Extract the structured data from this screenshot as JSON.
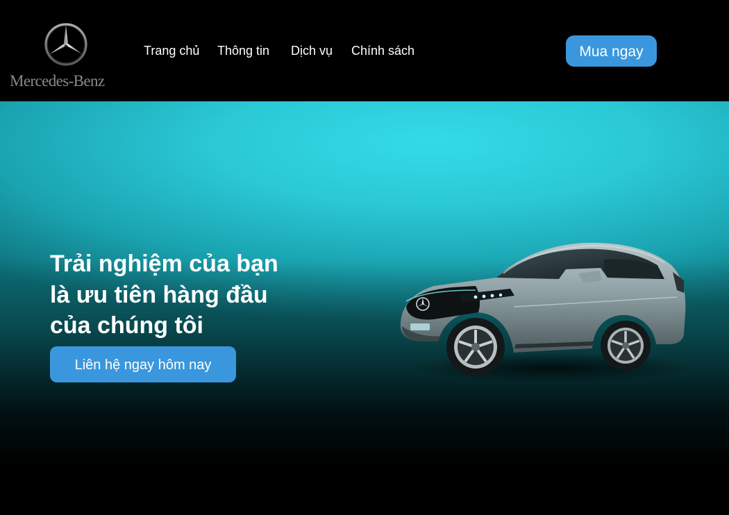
{
  "brand": {
    "name": "Mercedes-Benz",
    "logo_icon": "mercedes-star-icon"
  },
  "nav": {
    "items": [
      {
        "label": "Trang chủ"
      },
      {
        "label": "Thông tin"
      },
      {
        "label": "Dịch vụ"
      },
      {
        "label": "Chính sách"
      }
    ]
  },
  "header": {
    "cta_label": "Mua ngay"
  },
  "hero": {
    "title_lines": [
      "Trải nghiệm của bạn",
      "là ưu tiên hàng đầu",
      "của chúng tôi"
    ],
    "cta_label": "Liên hệ ngay hôm nay",
    "image": "electric-suv-car"
  },
  "colors": {
    "accent": "#3a97dd",
    "hero_cyan": "#33dbe6",
    "background": "#000000"
  }
}
